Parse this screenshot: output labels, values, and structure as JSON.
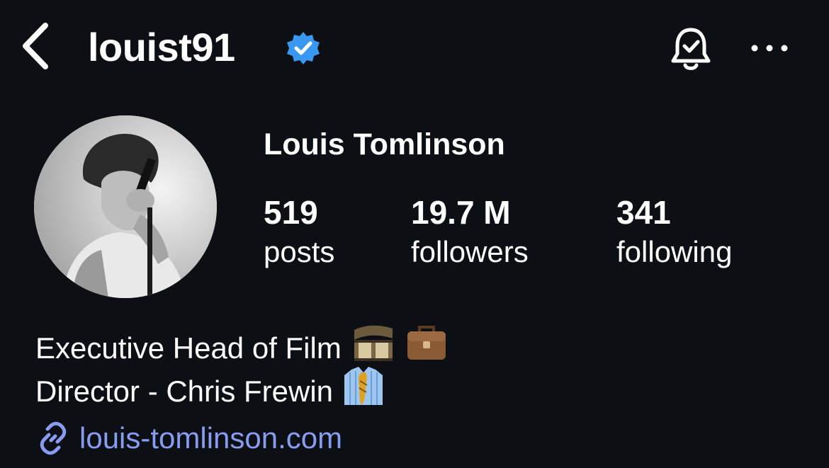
{
  "header": {
    "username": "louist91",
    "back_icon": "chevron-left-icon",
    "verified_icon": "verified-badge-icon",
    "notifications_icon": "bell-check-icon",
    "more_icon": "more-horizontal-icon",
    "verified_color": "#3897f0"
  },
  "profile": {
    "display_name": "Louis Tomlinson",
    "avatar_icon": "profile-photo",
    "stats": [
      {
        "value": "519",
        "label": "posts"
      },
      {
        "value": "19.7 M",
        "label": "followers"
      },
      {
        "value": "341",
        "label": "following"
      }
    ],
    "bio": {
      "line1": "Executive Head of Film",
      "line1_emojis": [
        "film-frames-emoji",
        "briefcase-emoji"
      ],
      "line2": "Director - Chris Frewin",
      "line2_emojis": [
        "shirt-tie-emoji"
      ]
    },
    "link": {
      "text": "louis-tomlinson.com",
      "icon": "link-icon",
      "color": "#8a9cf0"
    }
  }
}
